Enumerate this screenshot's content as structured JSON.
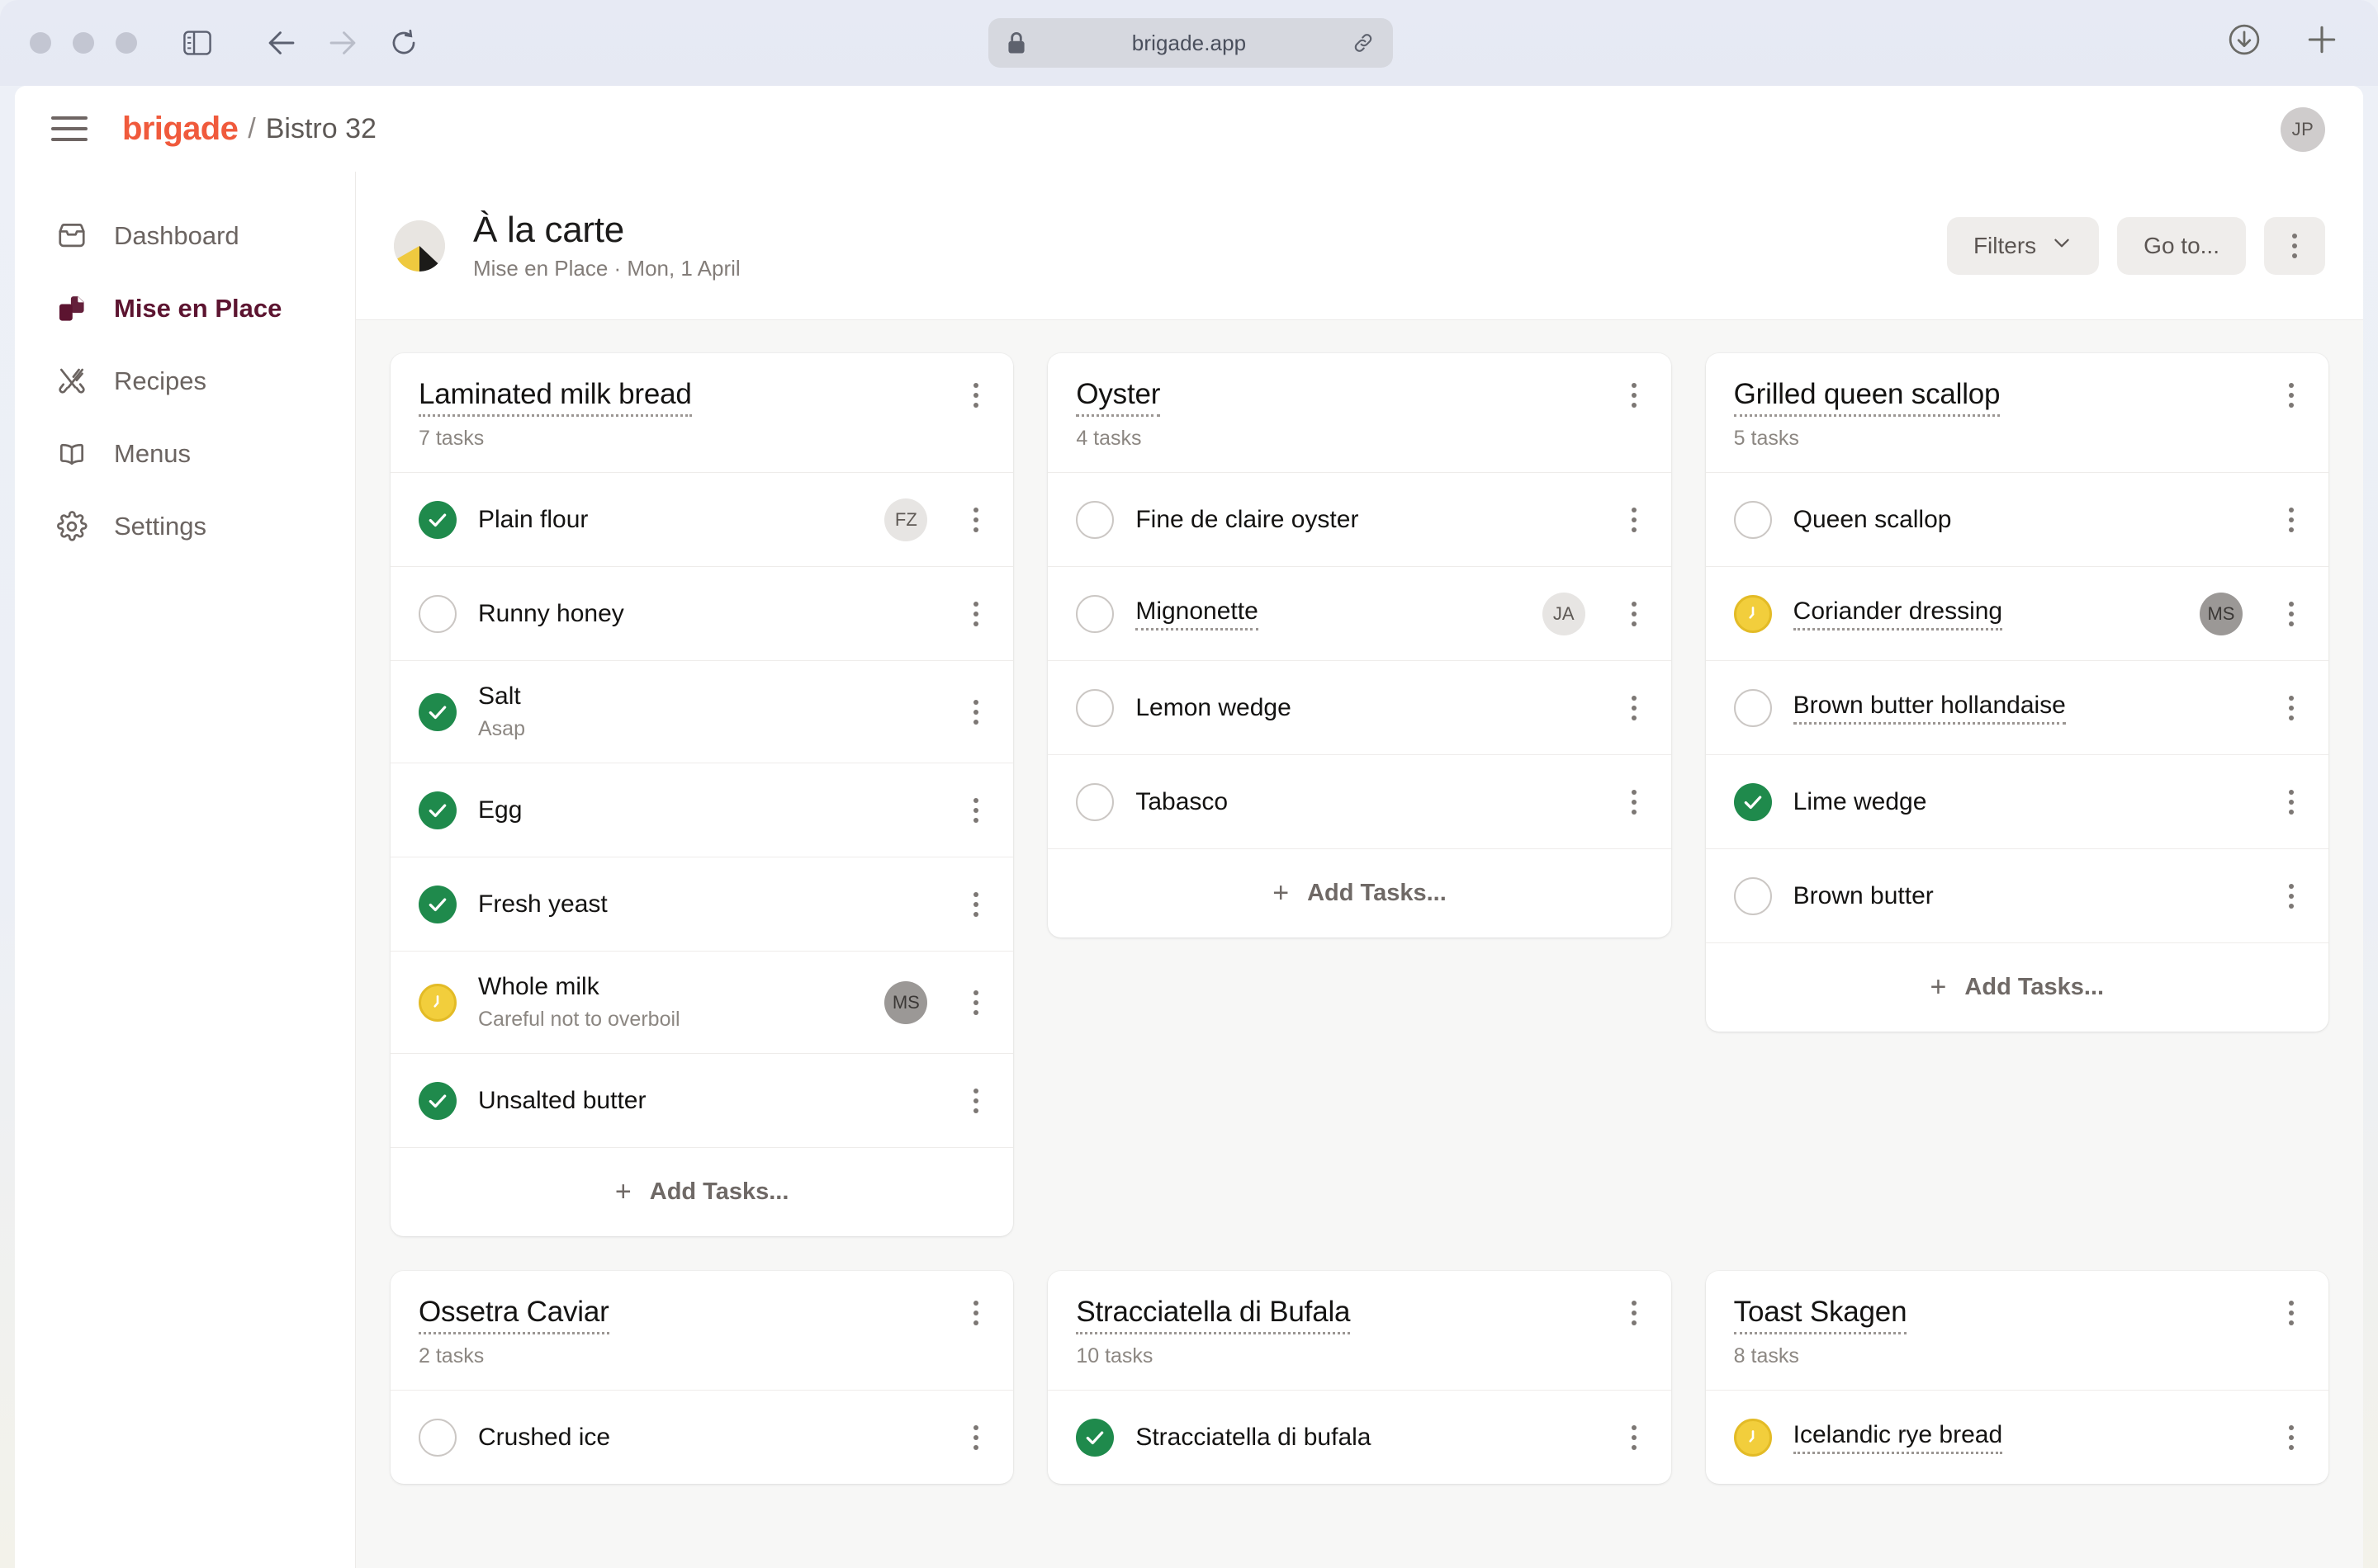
{
  "browser": {
    "url": "brigade.app",
    "lock_icon": "lock-icon",
    "share_icon": "link-icon",
    "download_icon": "download-icon",
    "new_tab_icon": "plus-icon",
    "back_icon": "arrow-left-icon",
    "forward_icon": "arrow-right-icon",
    "reload_icon": "reload-icon",
    "sidebar_icon": "sidebar-toggle-icon"
  },
  "header": {
    "brand": "brigade",
    "separator": "/",
    "workspace": "Bistro 32",
    "avatar_initials": "JP"
  },
  "sidebar": {
    "items": [
      {
        "label": "Dashboard",
        "icon": "inbox-icon",
        "active": false
      },
      {
        "label": "Mise en Place",
        "icon": "prep-docs-icon",
        "active": true
      },
      {
        "label": "Recipes",
        "icon": "cutlery-icon",
        "active": false
      },
      {
        "label": "Menus",
        "icon": "book-icon",
        "active": false
      },
      {
        "label": "Settings",
        "icon": "gear-icon",
        "active": false
      }
    ]
  },
  "board_header": {
    "title": "À la carte",
    "subtitle": "Mise en Place · Mon, 1 April",
    "avatar_icon": "progress-pie-avatar",
    "filters_label": "Filters",
    "filters_chevron": "chevron-down-icon",
    "goto_label": "Go to...",
    "more_icon": "kebab-menu-icon"
  },
  "board": {
    "add_tasks_label": "Add Tasks...",
    "add_icon": "plus-icon",
    "cards": [
      {
        "title": "Laminated milk bread",
        "count": "7 tasks",
        "show_add": true,
        "tasks": [
          {
            "title": "Plain flour",
            "status": "done",
            "note": null,
            "avatar": "FZ",
            "avatar_tone": "light",
            "linked": false
          },
          {
            "title": "Runny honey",
            "status": "todo",
            "note": null,
            "avatar": null,
            "avatar_tone": null,
            "linked": false
          },
          {
            "title": "Salt",
            "status": "done",
            "note": "Asap",
            "avatar": null,
            "avatar_tone": null,
            "linked": false
          },
          {
            "title": "Egg",
            "status": "done",
            "note": null,
            "avatar": null,
            "avatar_tone": null,
            "linked": false
          },
          {
            "title": "Fresh yeast",
            "status": "done",
            "note": null,
            "avatar": null,
            "avatar_tone": null,
            "linked": false
          },
          {
            "title": "Whole milk",
            "status": "progress",
            "note": "Careful not to overboil",
            "avatar": "MS",
            "avatar_tone": "dark",
            "linked": false
          },
          {
            "title": "Unsalted butter",
            "status": "done",
            "note": null,
            "avatar": null,
            "avatar_tone": null,
            "linked": false
          }
        ]
      },
      {
        "title": "Oyster",
        "count": "4 tasks",
        "show_add": true,
        "tasks": [
          {
            "title": "Fine de claire oyster",
            "status": "todo",
            "note": null,
            "avatar": null,
            "avatar_tone": null,
            "linked": false
          },
          {
            "title": "Mignonette",
            "status": "todo",
            "note": null,
            "avatar": "JA",
            "avatar_tone": "light",
            "linked": true
          },
          {
            "title": "Lemon wedge",
            "status": "todo",
            "note": null,
            "avatar": null,
            "avatar_tone": null,
            "linked": false
          },
          {
            "title": "Tabasco",
            "status": "todo",
            "note": null,
            "avatar": null,
            "avatar_tone": null,
            "linked": false
          }
        ]
      },
      {
        "title": "Grilled queen scallop",
        "count": "5 tasks",
        "show_add": true,
        "tasks": [
          {
            "title": "Queen scallop",
            "status": "todo",
            "note": null,
            "avatar": null,
            "avatar_tone": null,
            "linked": false
          },
          {
            "title": "Coriander dressing",
            "status": "progress",
            "note": null,
            "avatar": "MS",
            "avatar_tone": "dark",
            "linked": true
          },
          {
            "title": "Brown butter hollandaise",
            "status": "todo",
            "note": null,
            "avatar": null,
            "avatar_tone": null,
            "linked": true
          },
          {
            "title": "Lime wedge",
            "status": "done",
            "note": null,
            "avatar": null,
            "avatar_tone": null,
            "linked": false
          },
          {
            "title": "Brown butter",
            "status": "todo",
            "note": null,
            "avatar": null,
            "avatar_tone": null,
            "linked": false
          }
        ]
      },
      {
        "title": "Ossetra Caviar",
        "count": "2 tasks",
        "show_add": false,
        "tasks": [
          {
            "title": "Crushed ice",
            "status": "todo",
            "note": null,
            "avatar": null,
            "avatar_tone": null,
            "linked": false
          }
        ]
      },
      {
        "title": "Stracciatella di Bufala",
        "count": "10 tasks",
        "show_add": false,
        "tasks": [
          {
            "title": "Stracciatella di bufala",
            "status": "done",
            "note": null,
            "avatar": null,
            "avatar_tone": null,
            "linked": false
          }
        ]
      },
      {
        "title": "Toast Skagen",
        "count": "8 tasks",
        "show_add": false,
        "tasks": [
          {
            "title": "Icelandic rye bread",
            "status": "progress",
            "note": null,
            "avatar": null,
            "avatar_tone": null,
            "linked": true
          }
        ]
      }
    ]
  },
  "colors": {
    "brand": "#f05a3c",
    "active_nav": "#5c1430",
    "done": "#1f8a4c",
    "progress": "#f2ce3c",
    "board_bg": "#f7f7f6"
  }
}
